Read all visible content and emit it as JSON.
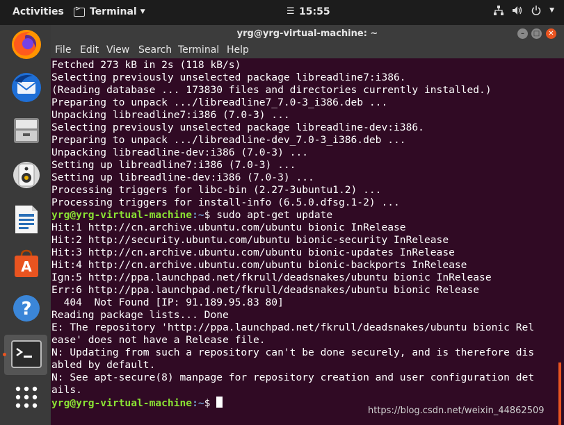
{
  "topbar": {
    "activities": "Activities",
    "app_name": "Terminal",
    "clock": "15:55"
  },
  "window": {
    "title": "yrg@yrg-virtual-machine: ~",
    "menu": [
      "File",
      "Edit",
      "View",
      "Search",
      "Terminal",
      "Help"
    ]
  },
  "terminal": {
    "lines": [
      "Fetched 273 kB in 2s (118 kB/s)",
      "Selecting previously unselected package libreadline7:i386.",
      "(Reading database ... 173830 files and directories currently installed.)",
      "Preparing to unpack .../libreadline7_7.0-3_i386.deb ...",
      "Unpacking libreadline7:i386 (7.0-3) ...",
      "Selecting previously unselected package libreadline-dev:i386.",
      "Preparing to unpack .../libreadline-dev_7.0-3_i386.deb ...",
      "Unpacking libreadline-dev:i386 (7.0-3) ...",
      "Setting up libreadline7:i386 (7.0-3) ...",
      "Setting up libreadline-dev:i386 (7.0-3) ...",
      "Processing triggers for libc-bin (2.27-3ubuntu1.2) ...",
      "Processing triggers for install-info (6.5.0.dfsg.1-2) ..."
    ],
    "prompt_user": "yrg@yrg-virtual-machine",
    "prompt_path": ":~",
    "prompt_symbol": "$ ",
    "command": "sudo apt-get update",
    "lines2": [
      "Hit:1 http://cn.archive.ubuntu.com/ubuntu bionic InRelease",
      "Hit:2 http://security.ubuntu.com/ubuntu bionic-security InRelease",
      "Hit:3 http://cn.archive.ubuntu.com/ubuntu bionic-updates InRelease",
      "Hit:4 http://cn.archive.ubuntu.com/ubuntu bionic-backports InRelease",
      "Ign:5 http://ppa.launchpad.net/fkrull/deadsnakes/ubuntu bionic InRelease",
      "Err:6 http://ppa.launchpad.net/fkrull/deadsnakes/ubuntu bionic Release",
      "  404  Not Found [IP: 91.189.95.83 80]",
      "Reading package lists... Done",
      "E: The repository 'http://ppa.launchpad.net/fkrull/deadsnakes/ubuntu bionic Rel",
      "ease' does not have a Release file.",
      "N: Updating from such a repository can't be done securely, and is therefore dis",
      "abled by default.",
      "N: See apt-secure(8) manpage for repository creation and user configuration det",
      "ails."
    ]
  },
  "watermark": "https://blog.csdn.net/weixin_44862509",
  "colors": {
    "prompt_user": "#8ae234",
    "prompt_path": "#729fcf",
    "accent": "#e95420"
  }
}
